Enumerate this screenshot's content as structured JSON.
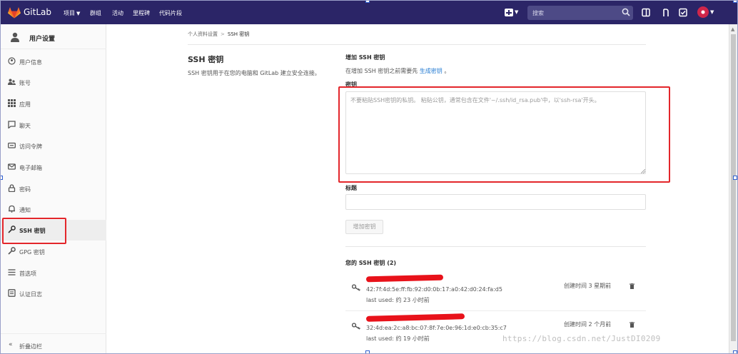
{
  "app": {
    "brand": "GitLab"
  },
  "topnav": {
    "links": [
      "项目",
      "群组",
      "活动",
      "里程碑",
      "代码片段"
    ],
    "search_placeholder": "搜索"
  },
  "sidebar": {
    "header": "用户设置",
    "items": [
      {
        "label": "用户信息",
        "icon": "profile-icon"
      },
      {
        "label": "账号",
        "icon": "account-icon"
      },
      {
        "label": "应用",
        "icon": "applications-icon"
      },
      {
        "label": "聊天",
        "icon": "chat-icon"
      },
      {
        "label": "访问令牌",
        "icon": "access-token-icon"
      },
      {
        "label": "电子邮箱",
        "icon": "email-icon"
      },
      {
        "label": "密码",
        "icon": "lock-icon"
      },
      {
        "label": "通知",
        "icon": "bell-icon"
      },
      {
        "label": "SSH 密钥",
        "icon": "key-icon",
        "active": true
      },
      {
        "label": "GPG 密钥",
        "icon": "key-icon"
      },
      {
        "label": "首选项",
        "icon": "preferences-icon"
      },
      {
        "label": "认证日志",
        "icon": "log-icon"
      }
    ],
    "collapse": "折叠边栏"
  },
  "breadcrumb": {
    "parent": "个人资料设置",
    "separator": ">",
    "current": "SSH 密钥"
  },
  "section": {
    "title": "SSH 密钥",
    "description": "SSH 密钥用于在您的电脑和 GitLab 建立安全连接。"
  },
  "form": {
    "title": "增加 SSH 密钥",
    "hint_prefix": "在增加 SSH 密钥之前需要先",
    "hint_link": "生成密钥",
    "hint_suffix": "。",
    "key_label": "密钥",
    "key_placeholder": "不要粘贴SSH密钥的私钥。 粘贴公钥，通常包含在文件'~/.ssh/id_rsa.pub'中，以'ssh-rsa'开头。",
    "title_label": "标题",
    "title_value": "",
    "submit_label": "增加密钥"
  },
  "keys": {
    "heading": "您的 SSH 密钥 (2)",
    "list": [
      {
        "fingerprint": "42:7f:4d:5e:ff:fb:92:d0:0b:17:a0:42:d0:24:fa:d5",
        "last_used": "last used: 约 23 小时前",
        "created": "创建时间 3 星期前"
      },
      {
        "fingerprint": "32:4d:ea:2c:a8:bc:07:8f:7e:0e:96:1d:e0:cb:35:c7",
        "last_used": "last used: 约 19 小时前",
        "created": "创建时间 2 个月前"
      }
    ]
  },
  "watermark": "https://blog.csdn.net/JustDI0209",
  "colors": {
    "nav_bg": "#2b2567",
    "highlight": "#e3262b",
    "link": "#1f78d1"
  }
}
